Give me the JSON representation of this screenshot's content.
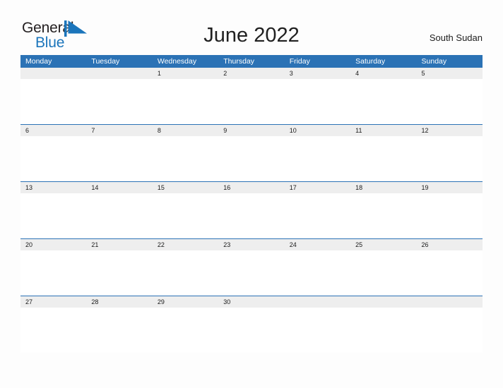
{
  "logo": {
    "word_one": "General",
    "word_two": "Blue",
    "mark_icon": "flag-triangle-icon",
    "mark_color": "#1b75bb",
    "word_one_color": "#231f20",
    "word_two_color": "#1b75bb"
  },
  "header": {
    "title": "June 2022",
    "country": "South Sudan"
  },
  "colors": {
    "header_blue": "#2b72b5",
    "date_strip_gray": "#eeeeee",
    "cell_white": "#ffffff",
    "page_background": "#fdfdfd",
    "text_dark": "#202020"
  },
  "calendar": {
    "weekday_headers": [
      "Monday",
      "Tuesday",
      "Wednesday",
      "Thursday",
      "Friday",
      "Saturday",
      "Sunday"
    ],
    "weeks": [
      [
        {
          "date": "",
          "events": ""
        },
        {
          "date": "",
          "events": ""
        },
        {
          "date": "1",
          "events": ""
        },
        {
          "date": "2",
          "events": ""
        },
        {
          "date": "3",
          "events": ""
        },
        {
          "date": "4",
          "events": ""
        },
        {
          "date": "5",
          "events": ""
        }
      ],
      [
        {
          "date": "6",
          "events": ""
        },
        {
          "date": "7",
          "events": ""
        },
        {
          "date": "8",
          "events": ""
        },
        {
          "date": "9",
          "events": ""
        },
        {
          "date": "10",
          "events": ""
        },
        {
          "date": "11",
          "events": ""
        },
        {
          "date": "12",
          "events": ""
        }
      ],
      [
        {
          "date": "13",
          "events": ""
        },
        {
          "date": "14",
          "events": ""
        },
        {
          "date": "15",
          "events": ""
        },
        {
          "date": "16",
          "events": ""
        },
        {
          "date": "17",
          "events": ""
        },
        {
          "date": "18",
          "events": ""
        },
        {
          "date": "19",
          "events": ""
        }
      ],
      [
        {
          "date": "20",
          "events": ""
        },
        {
          "date": "21",
          "events": ""
        },
        {
          "date": "22",
          "events": ""
        },
        {
          "date": "23",
          "events": ""
        },
        {
          "date": "24",
          "events": ""
        },
        {
          "date": "25",
          "events": ""
        },
        {
          "date": "26",
          "events": ""
        }
      ],
      [
        {
          "date": "27",
          "events": ""
        },
        {
          "date": "28",
          "events": ""
        },
        {
          "date": "29",
          "events": ""
        },
        {
          "date": "30",
          "events": ""
        },
        {
          "date": "",
          "events": ""
        },
        {
          "date": "",
          "events": ""
        },
        {
          "date": "",
          "events": ""
        }
      ]
    ]
  }
}
